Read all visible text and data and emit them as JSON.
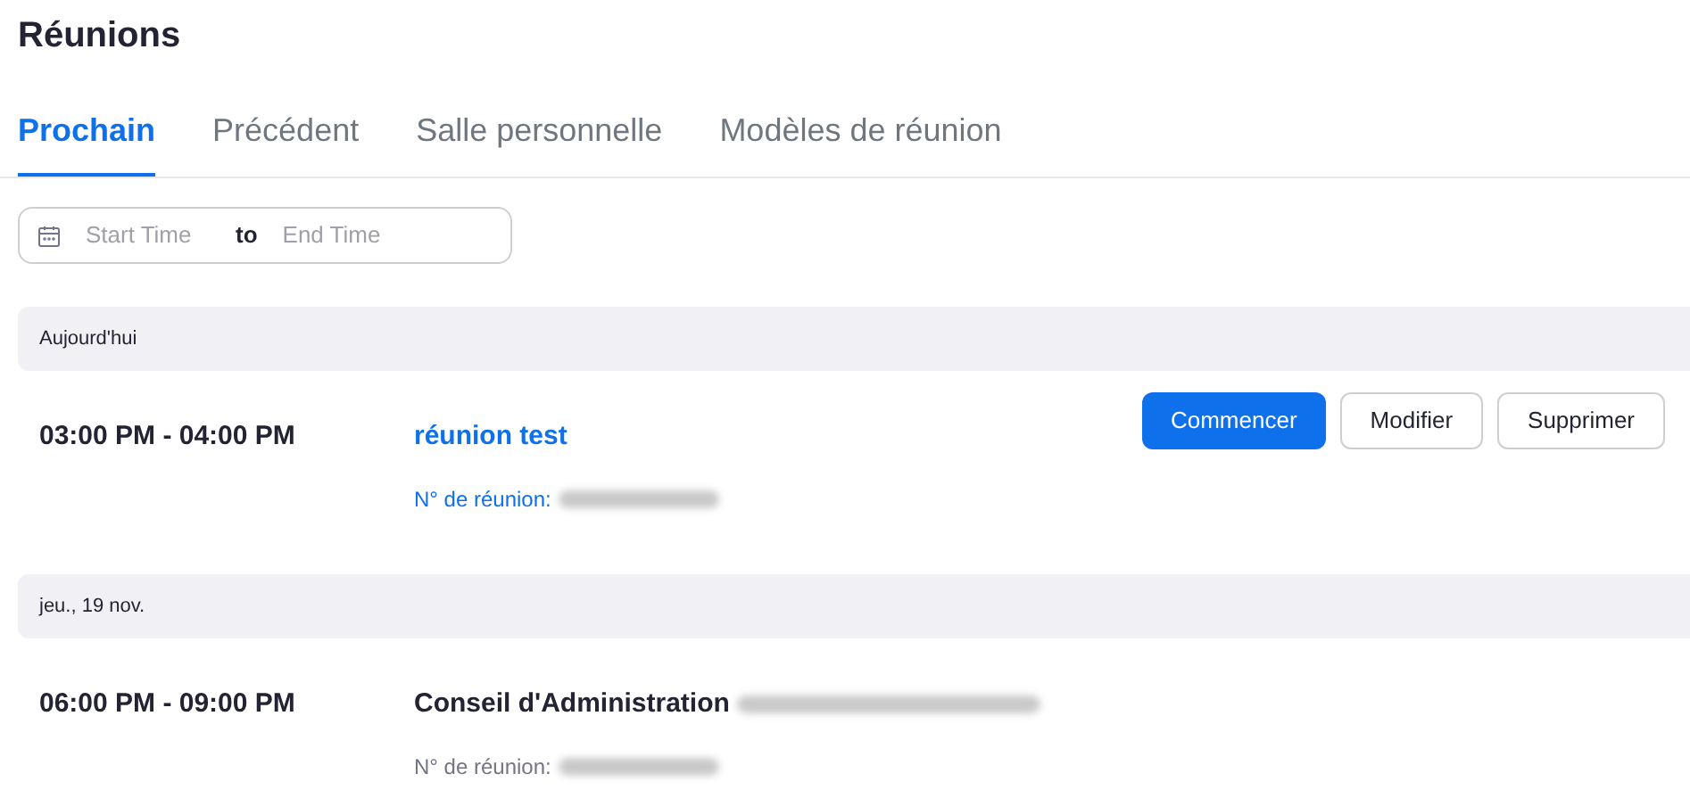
{
  "title": "Réunions",
  "tabs": [
    {
      "label": "Prochain",
      "selected": true
    },
    {
      "label": "Précédent",
      "selected": false
    },
    {
      "label": "Salle personnelle",
      "selected": false
    },
    {
      "label": "Modèles de réunion",
      "selected": false
    }
  ],
  "date_range": {
    "start_placeholder": "Start Time",
    "separator": "to",
    "end_placeholder": "End Time"
  },
  "days": [
    {
      "label": "Aujourd'hui",
      "meetings": [
        {
          "time": "03:00 PM - 04:00 PM",
          "topic": "réunion test",
          "kind": "link",
          "id_label": "N° de réunion:",
          "buttons": [
            {
              "label": "Commencer",
              "primary": true
            },
            {
              "label": "Modifier",
              "primary": false
            },
            {
              "label": "Supprimer",
              "primary": false
            }
          ]
        }
      ]
    },
    {
      "label": "jeu., 19 nov.",
      "meetings": [
        {
          "time": "06:00 PM - 09:00 PM",
          "topic": "Conseil d'Administration",
          "kind": "plain",
          "topic_redacted": true,
          "id_label": "N° de réunion:"
        }
      ]
    }
  ]
}
